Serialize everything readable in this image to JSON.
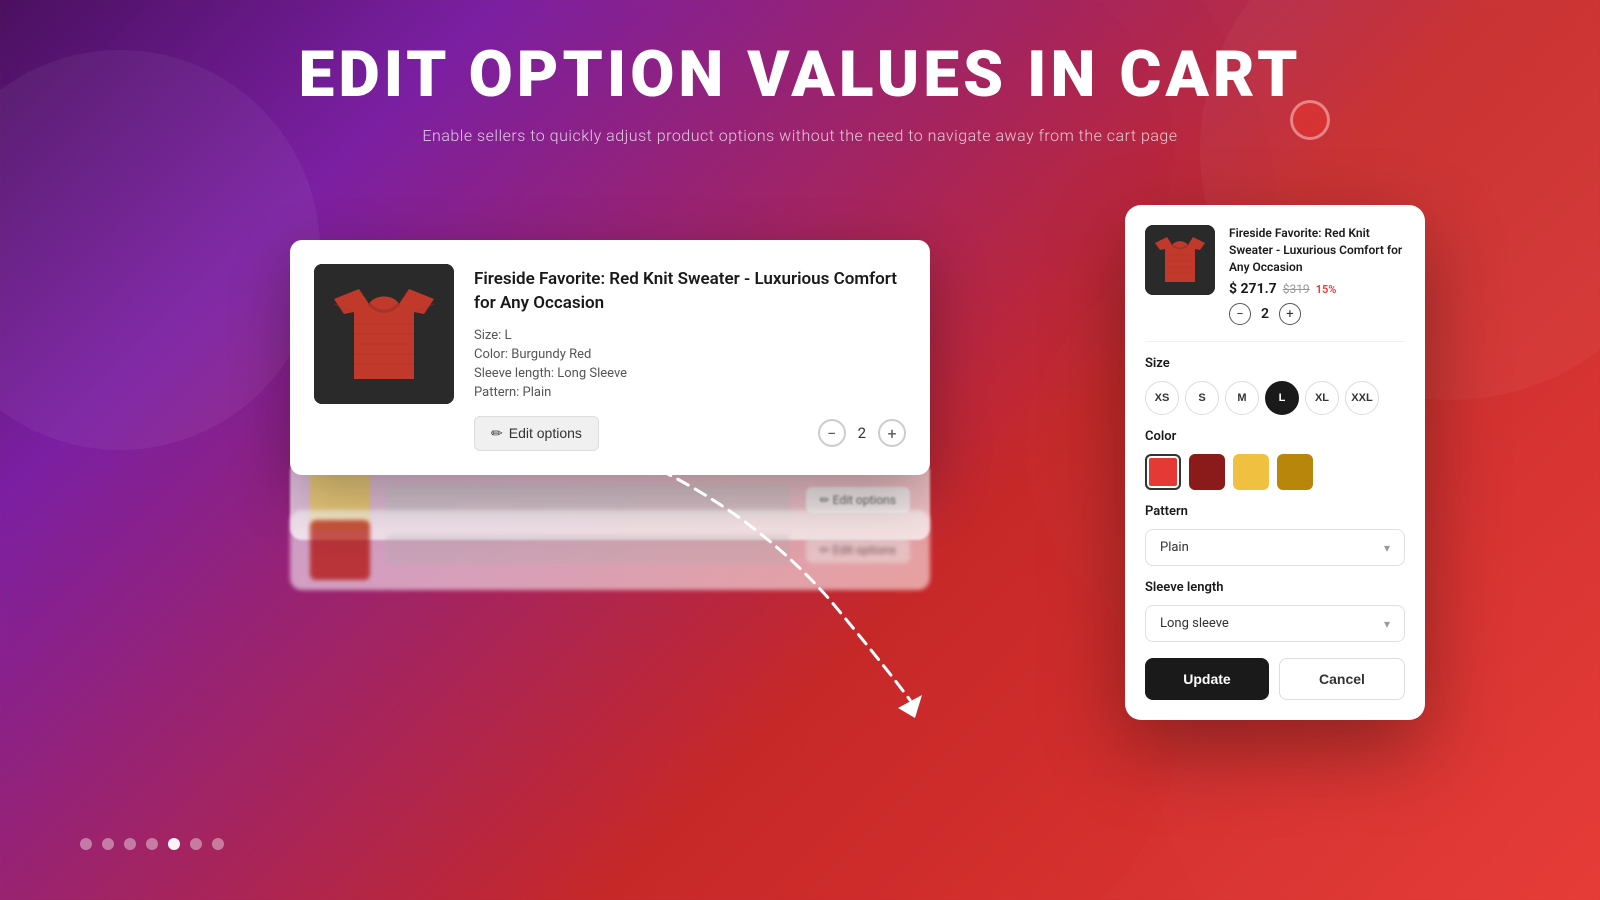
{
  "page": {
    "title": "EDIT OPTION VALUES IN CART",
    "subtitle": "Enable sellers to quickly adjust product options without the need to navigate away from the cart page"
  },
  "product": {
    "title": "Fireside Favorite: Red Knit Sweater - Luxurious Comfort for Any Occasion",
    "price_current": "$ 271.7",
    "price_original": "$319",
    "price_discount": "15%",
    "quantity": 2,
    "options": {
      "size_label": "Size: L",
      "color_label": "Color: Burgundy Red",
      "sleeve_label": "Sleeve length: Long Sleeve",
      "pattern_label": "Pattern: Plain"
    }
  },
  "cart": {
    "item_title": "Fireside Favorite: Red Knit Sweater - Luxurious Comfort for Any Occasion",
    "edit_options_label": "Edit options",
    "edit_icon": "✏",
    "qty": "2"
  },
  "detail_panel": {
    "product_title": "Fireside Favorite: Red Knit Sweater - Luxurious Comfort for Any Occasion",
    "price_current": "$ 271.7",
    "price_original": "$319",
    "price_discount": "15%",
    "qty": "2",
    "size_label": "Size",
    "sizes": [
      "XS",
      "S",
      "M",
      "L",
      "XL",
      "XXL"
    ],
    "active_size": "L",
    "color_label": "Color",
    "colors": [
      "#e53935",
      "#8b1a1a",
      "#f0c040",
      "#b8860b"
    ],
    "active_color_index": 0,
    "pattern_label": "Pattern",
    "pattern_value": "Plain",
    "sleeve_label": "Sleeve length",
    "sleeve_value": "Long sleeve",
    "update_btn": "Update",
    "cancel_btn": "Cancel"
  },
  "pagination": {
    "dots": 7,
    "active": 4
  }
}
